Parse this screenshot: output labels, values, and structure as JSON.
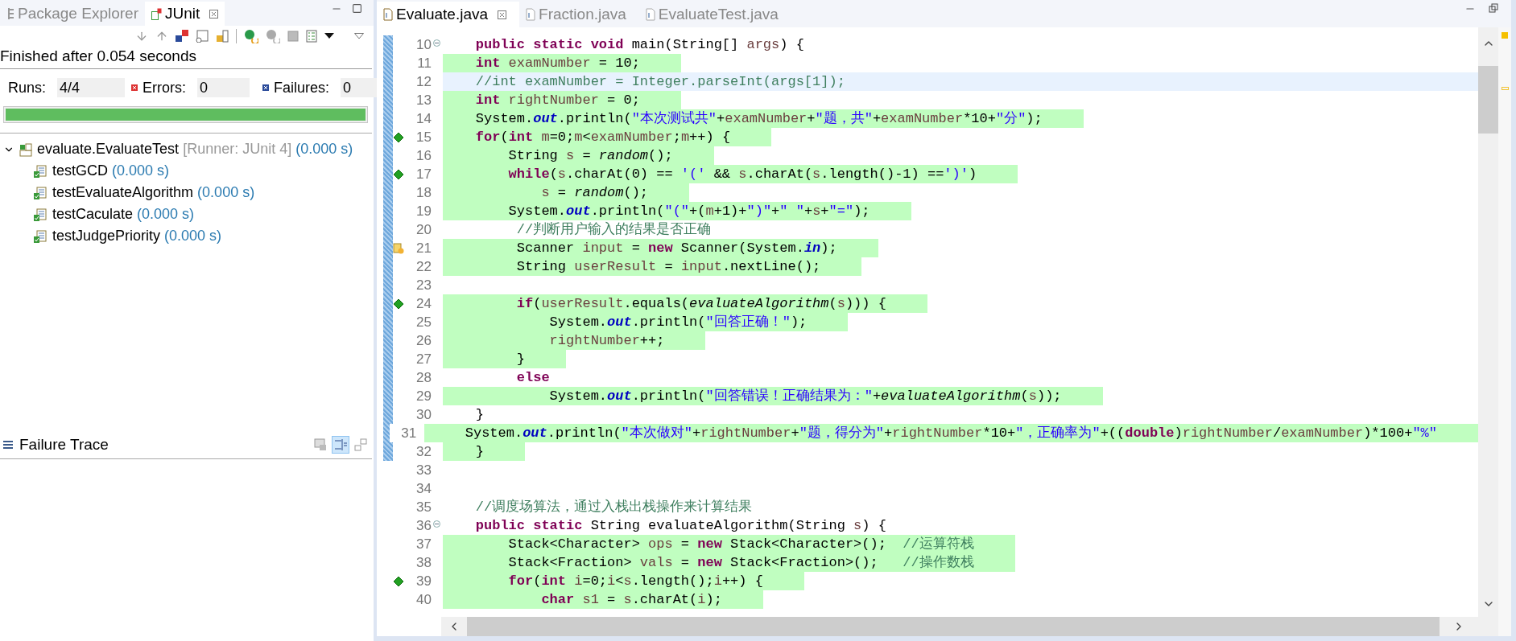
{
  "left_panel": {
    "tabs": [
      {
        "label": "Package Explorer",
        "selected": false
      },
      {
        "label": "JUnit",
        "selected": true
      }
    ],
    "status": "Finished after 0.054 seconds",
    "counters": [
      {
        "kind": "runs",
        "label": "Runs:",
        "value": "4/4"
      },
      {
        "kind": "errors",
        "label": "Errors:",
        "value": "0"
      },
      {
        "kind": "failures",
        "label": "Failures:",
        "value": "0"
      }
    ],
    "progress": {
      "level": 1
    },
    "tree": {
      "label": "evaluate.EvaluateTest",
      "runner": "[Runner: JUnit 4]",
      "time": "(0.000 s)",
      "expanded": true,
      "children": [
        {
          "label": "testGCD",
          "time": "(0.000 s)"
        },
        {
          "label": "testEvaluateAlgorithm",
          "time": "(0.000 s)"
        },
        {
          "label": "testCaculate",
          "time": "(0.000 s)"
        },
        {
          "label": "testJudgePriority",
          "time": "(0.000 s)"
        }
      ]
    },
    "failure_trace": {
      "title": "Failure Trace"
    }
  },
  "editor": {
    "tabs": [
      {
        "label": "Evaluate.java",
        "selected": true
      },
      {
        "label": "Fraction.java",
        "selected": false
      },
      {
        "label": "EvaluateTest.java",
        "selected": false
      }
    ],
    "lines": [
      {
        "number": "10",
        "covered": false,
        "changed": true,
        "marker": {
          "kind": "fold"
        },
        "segments": [
          {
            "kind": "keyword",
            "text": "    public static void"
          },
          {
            "kind": "plain",
            "text": " main(String[] "
          },
          {
            "kind": "local",
            "text": "args"
          },
          {
            "kind": "plain",
            "text": ") {"
          }
        ]
      },
      {
        "number": "11",
        "covered": true,
        "changed": true,
        "segments": [
          {
            "kind": "keyword",
            "text": "    int"
          },
          {
            "kind": "local",
            "text": " examNumber"
          },
          {
            "kind": "plain",
            "text": " = 10;"
          }
        ]
      },
      {
        "number": "12",
        "covered": false,
        "changed": true,
        "current": true,
        "segments": [
          {
            "kind": "comment",
            "text": "    //int examNumber = Integer.parseInt(args[1]);"
          }
        ]
      },
      {
        "number": "13",
        "covered": true,
        "changed": true,
        "segments": [
          {
            "kind": "keyword",
            "text": "    int"
          },
          {
            "kind": "local",
            "text": " rightNumber"
          },
          {
            "kind": "plain",
            "text": " = 0;"
          }
        ]
      },
      {
        "number": "14",
        "covered": true,
        "changed": true,
        "segments": [
          {
            "kind": "plain",
            "text": "    System."
          },
          {
            "kind": "field",
            "text": "out"
          },
          {
            "kind": "plain",
            "text": ".println("
          },
          {
            "kind": "string",
            "text": "\"本次测试共\""
          },
          {
            "kind": "plain",
            "text": "+"
          },
          {
            "kind": "local",
            "text": "examNumber"
          },
          {
            "kind": "plain",
            "text": "+"
          },
          {
            "kind": "string",
            "text": "\"题，共\""
          },
          {
            "kind": "plain",
            "text": "+"
          },
          {
            "kind": "local",
            "text": "examNumber"
          },
          {
            "kind": "plain",
            "text": "*10+"
          },
          {
            "kind": "string",
            "text": "\"分\""
          },
          {
            "kind": "plain",
            "text": ");"
          }
        ]
      },
      {
        "number": "15",
        "covered": true,
        "changed": true,
        "marker": {
          "kind": "coverage"
        },
        "segments": [
          {
            "kind": "keyword",
            "text": "    for"
          },
          {
            "kind": "plain",
            "text": "("
          },
          {
            "kind": "keyword",
            "text": "int"
          },
          {
            "kind": "local",
            "text": " m"
          },
          {
            "kind": "plain",
            "text": "=0;"
          },
          {
            "kind": "local",
            "text": "m"
          },
          {
            "kind": "plain",
            "text": "<"
          },
          {
            "kind": "local",
            "text": "examNumber"
          },
          {
            "kind": "plain",
            "text": ";"
          },
          {
            "kind": "local",
            "text": "m"
          },
          {
            "kind": "plain",
            "text": "++) {"
          }
        ]
      },
      {
        "number": "16",
        "covered": true,
        "changed": true,
        "segments": [
          {
            "kind": "plain",
            "text": "        String "
          },
          {
            "kind": "local",
            "text": "s"
          },
          {
            "kind": "plain",
            "text": " = "
          },
          {
            "kind": "static",
            "text": "random"
          },
          {
            "kind": "plain",
            "text": "();"
          }
        ]
      },
      {
        "number": "17",
        "covered": true,
        "changed": true,
        "marker": {
          "kind": "coverage"
        },
        "segments": [
          {
            "kind": "keyword",
            "text": "        while"
          },
          {
            "kind": "plain",
            "text": "("
          },
          {
            "kind": "local",
            "text": "s"
          },
          {
            "kind": "plain",
            "text": ".charAt(0) == "
          },
          {
            "kind": "string",
            "text": "'('"
          },
          {
            "kind": "plain",
            "text": " && "
          },
          {
            "kind": "local",
            "text": "s"
          },
          {
            "kind": "plain",
            "text": ".charAt("
          },
          {
            "kind": "local",
            "text": "s"
          },
          {
            "kind": "plain",
            "text": ".length()-1) =="
          },
          {
            "kind": "string",
            "text": "')'"
          },
          {
            "kind": "plain",
            "text": ")"
          }
        ]
      },
      {
        "number": "18",
        "covered": true,
        "changed": true,
        "segments": [
          {
            "kind": "local",
            "text": "            s"
          },
          {
            "kind": "plain",
            "text": " = "
          },
          {
            "kind": "static",
            "text": "random"
          },
          {
            "kind": "plain",
            "text": "();"
          }
        ]
      },
      {
        "number": "19",
        "covered": true,
        "changed": true,
        "segments": [
          {
            "kind": "plain",
            "text": "        System."
          },
          {
            "kind": "field",
            "text": "out"
          },
          {
            "kind": "plain",
            "text": ".println("
          },
          {
            "kind": "string",
            "text": "\"(\""
          },
          {
            "kind": "plain",
            "text": "+("
          },
          {
            "kind": "local",
            "text": "m"
          },
          {
            "kind": "plain",
            "text": "+1)+"
          },
          {
            "kind": "string",
            "text": "\")\""
          },
          {
            "kind": "plain",
            "text": "+"
          },
          {
            "kind": "string",
            "text": "\" \""
          },
          {
            "kind": "plain",
            "text": "+"
          },
          {
            "kind": "local",
            "text": "s"
          },
          {
            "kind": "plain",
            "text": "+"
          },
          {
            "kind": "string",
            "text": "\"=\""
          },
          {
            "kind": "plain",
            "text": ");"
          }
        ]
      },
      {
        "number": "20",
        "covered": false,
        "changed": true,
        "segments": [
          {
            "kind": "comment",
            "text": "         //判断用户输入的结果是否正确"
          }
        ]
      },
      {
        "number": "21",
        "covered": true,
        "changed": true,
        "marker": {
          "kind": "warning"
        },
        "segments": [
          {
            "kind": "plain",
            "text": "         Scanner "
          },
          {
            "kind": "local",
            "text": "input"
          },
          {
            "kind": "plain",
            "text": " = "
          },
          {
            "kind": "keyword",
            "text": "new"
          },
          {
            "kind": "plain",
            "text": " Scanner(System."
          },
          {
            "kind": "field",
            "text": "in"
          },
          {
            "kind": "plain",
            "text": ");"
          }
        ]
      },
      {
        "number": "22",
        "covered": true,
        "changed": true,
        "segments": [
          {
            "kind": "plain",
            "text": "         String "
          },
          {
            "kind": "local",
            "text": "userResult"
          },
          {
            "kind": "plain",
            "text": " = "
          },
          {
            "kind": "local",
            "text": "input"
          },
          {
            "kind": "plain",
            "text": ".nextLine();"
          }
        ]
      },
      {
        "number": "23",
        "covered": false,
        "changed": true
      },
      {
        "number": "24",
        "covered": true,
        "changed": true,
        "marker": {
          "kind": "coverage"
        },
        "segments": [
          {
            "kind": "keyword",
            "text": "         if"
          },
          {
            "kind": "plain",
            "text": "("
          },
          {
            "kind": "local",
            "text": "userResult"
          },
          {
            "kind": "plain",
            "text": ".equals("
          },
          {
            "kind": "static",
            "text": "evaluateAlgorithm"
          },
          {
            "kind": "plain",
            "text": "("
          },
          {
            "kind": "local",
            "text": "s"
          },
          {
            "kind": "plain",
            "text": "))) {"
          }
        ]
      },
      {
        "number": "25",
        "covered": true,
        "changed": true,
        "segments": [
          {
            "kind": "plain",
            "text": "             System."
          },
          {
            "kind": "field",
            "text": "out"
          },
          {
            "kind": "plain",
            "text": ".println("
          },
          {
            "kind": "string",
            "text": "\"回答正确！\""
          },
          {
            "kind": "plain",
            "text": ");"
          }
        ]
      },
      {
        "number": "26",
        "covered": true,
        "changed": true,
        "segments": [
          {
            "kind": "local",
            "text": "             rightNumber"
          },
          {
            "kind": "plain",
            "text": "++;"
          }
        ]
      },
      {
        "number": "27",
        "covered": true,
        "changed": true,
        "segments": [
          {
            "kind": "plain",
            "text": "         }"
          }
        ]
      },
      {
        "number": "28",
        "covered": false,
        "changed": true,
        "segments": [
          {
            "kind": "keyword",
            "text": "         else"
          }
        ]
      },
      {
        "number": "29",
        "covered": true,
        "changed": true,
        "segments": [
          {
            "kind": "plain",
            "text": "             System."
          },
          {
            "kind": "field",
            "text": "out"
          },
          {
            "kind": "plain",
            "text": ".println("
          },
          {
            "kind": "string",
            "text": "\"回答错误！正确结果为：\""
          },
          {
            "kind": "plain",
            "text": "+"
          },
          {
            "kind": "static",
            "text": "evaluateAlgorithm"
          },
          {
            "kind": "plain",
            "text": "("
          },
          {
            "kind": "local",
            "text": "s"
          },
          {
            "kind": "plain",
            "text": "));"
          }
        ]
      },
      {
        "number": "30",
        "covered": false,
        "changed": true,
        "segments": [
          {
            "kind": "plain",
            "text": "    }"
          }
        ]
      },
      {
        "number": "31",
        "covered": true,
        "changed": true,
        "segments": [
          {
            "kind": "plain",
            "text": "     System."
          },
          {
            "kind": "field",
            "text": "out"
          },
          {
            "kind": "plain",
            "text": ".println("
          },
          {
            "kind": "string",
            "text": "\"本次做对\""
          },
          {
            "kind": "plain",
            "text": "+"
          },
          {
            "kind": "local",
            "text": "rightNumber"
          },
          {
            "kind": "plain",
            "text": "+"
          },
          {
            "kind": "string",
            "text": "\"题，得分为\""
          },
          {
            "kind": "plain",
            "text": "+"
          },
          {
            "kind": "local",
            "text": "rightNumber"
          },
          {
            "kind": "plain",
            "text": "*10+"
          },
          {
            "kind": "string",
            "text": "\"，正确率为\""
          },
          {
            "kind": "plain",
            "text": "+(("
          },
          {
            "kind": "keyword",
            "text": "double"
          },
          {
            "kind": "plain",
            "text": ")"
          },
          {
            "kind": "local",
            "text": "rightNumber"
          },
          {
            "kind": "plain",
            "text": "/"
          },
          {
            "kind": "local",
            "text": "examNumber"
          },
          {
            "kind": "plain",
            "text": ")*100+"
          },
          {
            "kind": "string",
            "text": "\"%\""
          }
        ]
      },
      {
        "number": "32",
        "covered": true,
        "changed": true,
        "segments": [
          {
            "kind": "plain",
            "text": "    }"
          }
        ]
      },
      {
        "number": "33",
        "covered": false,
        "changed": false
      },
      {
        "number": "34",
        "covered": false,
        "changed": false
      },
      {
        "number": "35",
        "covered": false,
        "changed": false,
        "segments": [
          {
            "kind": "comment",
            "text": "    //调度场算法，通过入栈出栈操作来计算结果"
          }
        ]
      },
      {
        "number": "36",
        "covered": false,
        "changed": false,
        "marker": {
          "kind": "fold"
        },
        "segments": [
          {
            "kind": "keyword",
            "text": "    public static"
          },
          {
            "kind": "plain",
            "text": " String evaluateAlgorithm(String "
          },
          {
            "kind": "local",
            "text": "s"
          },
          {
            "kind": "plain",
            "text": ") {"
          }
        ]
      },
      {
        "number": "37",
        "covered": true,
        "changed": false,
        "segments": [
          {
            "kind": "plain",
            "text": "        Stack<Character> "
          },
          {
            "kind": "local",
            "text": "ops"
          },
          {
            "kind": "plain",
            "text": " = "
          },
          {
            "kind": "keyword",
            "text": "new"
          },
          {
            "kind": "plain",
            "text": " Stack<Character>();  "
          },
          {
            "kind": "comment",
            "text": "//运算符栈"
          }
        ]
      },
      {
        "number": "38",
        "covered": true,
        "changed": false,
        "segments": [
          {
            "kind": "plain",
            "text": "        Stack<Fraction> "
          },
          {
            "kind": "local",
            "text": "vals"
          },
          {
            "kind": "plain",
            "text": " = "
          },
          {
            "kind": "keyword",
            "text": "new"
          },
          {
            "kind": "plain",
            "text": " Stack<Fraction>();   "
          },
          {
            "kind": "comment",
            "text": "//操作数栈"
          }
        ]
      },
      {
        "number": "39",
        "covered": true,
        "changed": false,
        "marker": {
          "kind": "coverage"
        },
        "segments": [
          {
            "kind": "keyword",
            "text": "        for"
          },
          {
            "kind": "plain",
            "text": "("
          },
          {
            "kind": "keyword",
            "text": "int"
          },
          {
            "kind": "local",
            "text": " i"
          },
          {
            "kind": "plain",
            "text": "=0;"
          },
          {
            "kind": "local",
            "text": "i"
          },
          {
            "kind": "plain",
            "text": "<"
          },
          {
            "kind": "local",
            "text": "s"
          },
          {
            "kind": "plain",
            "text": ".length();"
          },
          {
            "kind": "local",
            "text": "i"
          },
          {
            "kind": "plain",
            "text": "++) {"
          }
        ]
      },
      {
        "number": "40",
        "covered": true,
        "changed": false,
        "segments": [
          {
            "kind": "keyword",
            "text": "            char"
          },
          {
            "kind": "local",
            "text": " s1"
          },
          {
            "kind": "plain",
            "text": " = "
          },
          {
            "kind": "local",
            "text": "s"
          },
          {
            "kind": "plain",
            "text": ".charAt("
          },
          {
            "kind": "local",
            "text": "i"
          },
          {
            "kind": "plain",
            "text": ");"
          }
        ]
      }
    ]
  }
}
